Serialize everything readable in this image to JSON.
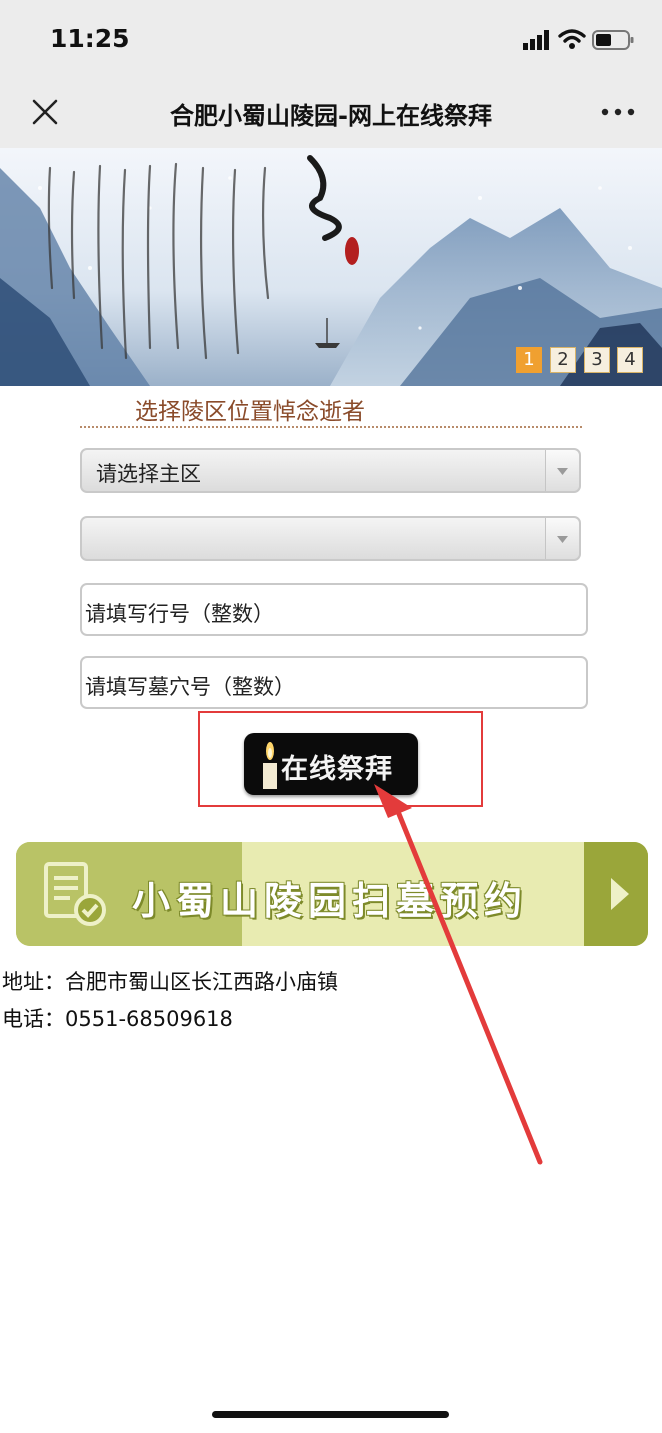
{
  "status_bar": {
    "time": "11:25"
  },
  "nav": {
    "title": "合肥小蜀山陵园-网上在线祭拜"
  },
  "banner": {
    "pages": [
      "1",
      "2",
      "3",
      "4"
    ],
    "active_page": 1
  },
  "form": {
    "section_title": "选择陵区位置悼念逝者",
    "main_area_select": {
      "value": "请选择主区"
    },
    "sub_area_select": {
      "value": ""
    },
    "row_input": {
      "placeholder": "请填写行号（整数）"
    },
    "grave_input": {
      "placeholder": "请填写墓穴号（整数）"
    },
    "worship_button_label": "在线祭拜"
  },
  "reservation_banner": {
    "label": "小蜀山陵园扫墓预约"
  },
  "contact": {
    "address": "地址：合肥市蜀山区长江西路小庙镇",
    "phone": "电话：0551-68509618"
  },
  "colors": {
    "highlight": "#e33b3b",
    "active_page": "#f0a030",
    "section_title": "#8a4b2a",
    "reservation_banner": "#c3cb6e"
  }
}
